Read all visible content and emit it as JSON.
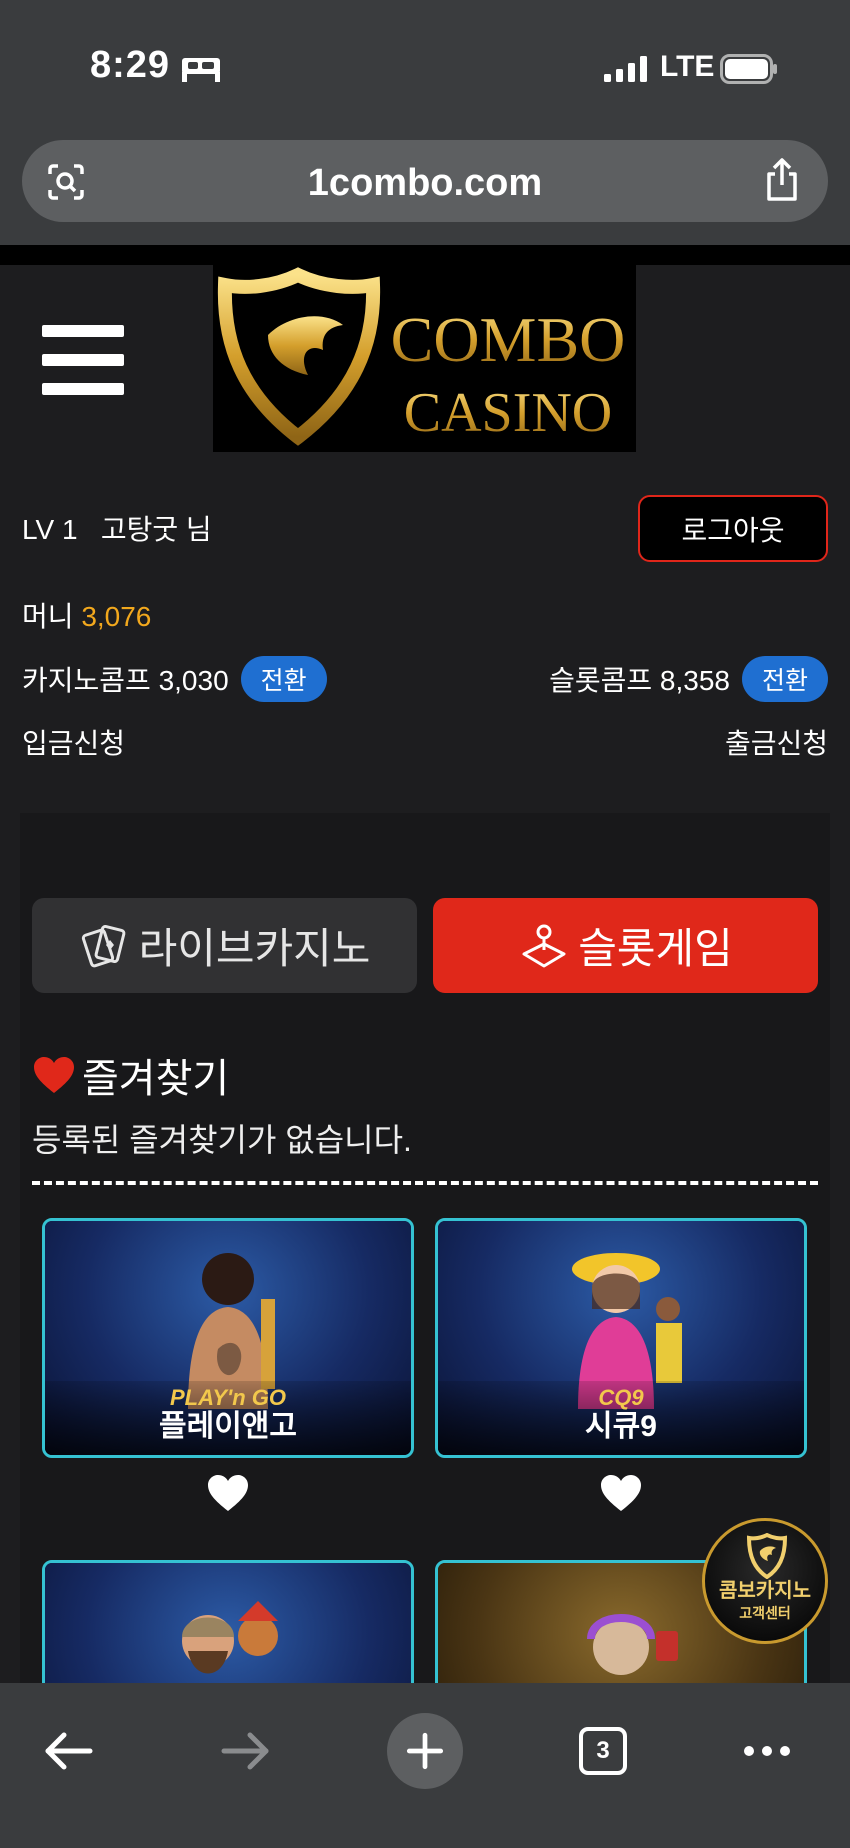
{
  "status_bar": {
    "time": "8:29",
    "network": "LTE"
  },
  "browser": {
    "url": "1combo.com",
    "tab_count": "3"
  },
  "logo": {
    "line1": "COMBO",
    "line2": "CASINO"
  },
  "user": {
    "level": "LV 1",
    "name": "고탕굿 님",
    "logout_label": "로그아웃",
    "money_label": "머니",
    "money_value": "3,076",
    "casino_comp_label": "카지노콤프 3,030",
    "slot_comp_label": "슬롯콤프 8,358",
    "convert_label": "전환",
    "deposit_label": "입금신청",
    "withdraw_label": "출금신청"
  },
  "tabs": {
    "live_casino": "라이브카지노",
    "slot_game": "슬롯게임"
  },
  "favorites": {
    "title": "즐겨찾기",
    "empty_message": "등록된 즐겨찾기가 없습니다."
  },
  "games": [
    {
      "brand": "PLAY'n GO",
      "title": "플레이앤고"
    },
    {
      "brand": "CQ9",
      "title": "시큐9"
    },
    {
      "brand": "",
      "title": ""
    },
    {
      "brand": "",
      "title": ""
    }
  ],
  "support_badge": {
    "line1": "콤보카지노",
    "line2": "고객센터"
  },
  "colors": {
    "accent_red": "#e0281a",
    "money_gold": "#f2a81d",
    "convert_blue": "#1f6fd1",
    "card_border": "#35c2d2"
  }
}
